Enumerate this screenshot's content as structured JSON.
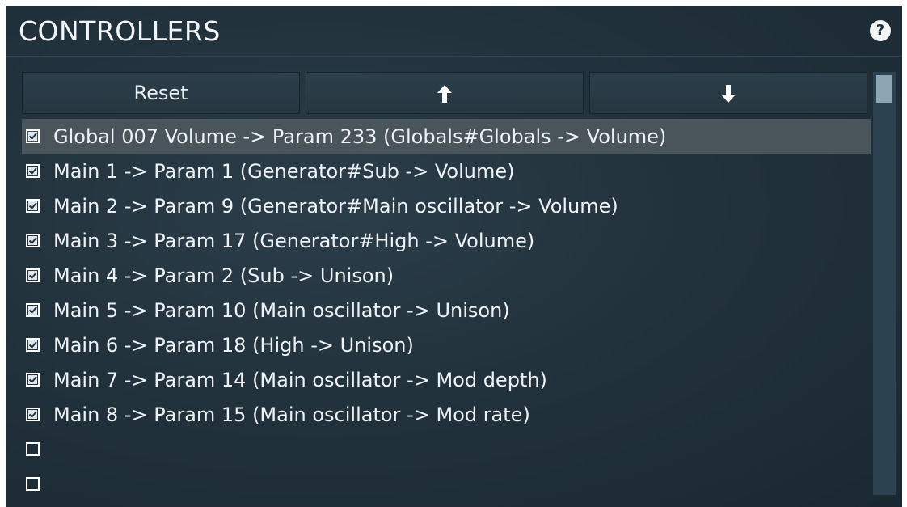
{
  "header": {
    "title": "CONTROLLERS",
    "help_icon": "help-icon",
    "help_label": "?"
  },
  "toolbar": {
    "reset_label": "Reset",
    "up_icon": "arrow-up-icon",
    "down_icon": "arrow-down-icon"
  },
  "list": {
    "selected_index": 0,
    "items": [
      {
        "label": "Global 007 Volume -> Param 233 (Globals#Globals -> Volume)",
        "checked": true
      },
      {
        "label": "Main 1 -> Param 1 (Generator#Sub -> Volume)",
        "checked": true
      },
      {
        "label": "Main 2 -> Param 9 (Generator#Main oscillator -> Volume)",
        "checked": true
      },
      {
        "label": "Main 3 -> Param 17 (Generator#High -> Volume)",
        "checked": true
      },
      {
        "label": "Main 4 -> Param 2 (Sub -> Unison)",
        "checked": true
      },
      {
        "label": "Main 5 -> Param 10 (Main oscillator -> Unison)",
        "checked": true
      },
      {
        "label": "Main 6 -> Param 18 (High -> Unison)",
        "checked": true
      },
      {
        "label": "Main 7 -> Param 14 (Main oscillator -> Mod depth)",
        "checked": true
      },
      {
        "label": "Main 8 -> Param 15 (Main oscillator -> Mod rate)",
        "checked": true
      },
      {
        "label": "",
        "checked": false
      },
      {
        "label": "",
        "checked": false
      }
    ]
  },
  "colors": {
    "panel_bg": "#22323c",
    "selected_row": "#49545b",
    "scroll_track": "#2d4250",
    "scroll_thumb": "#8ea5b3"
  }
}
